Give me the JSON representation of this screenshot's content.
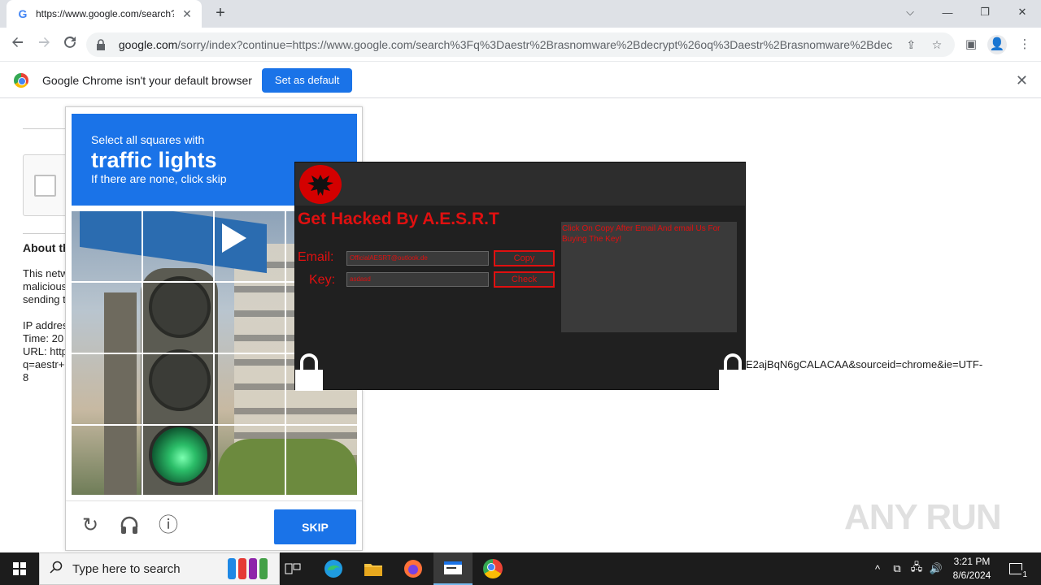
{
  "browser": {
    "tab_title": "https://www.google.com/search?",
    "tab_favicon": "G",
    "tab_close": "✕",
    "new_tab": "+",
    "window_controls": [
      "⌵",
      "—",
      "❐",
      "✕"
    ],
    "url_host": "google.com",
    "url_rest": "/sorry/index?continue=https://www.google.com/search%3Fq%3Daestr%2Brasnomware%2Bdecrypt%26oq%3Daestr%2Brasnomware%2Bdecrypt…"
  },
  "infobar": {
    "message": "Google Chrome isn't your default browser",
    "button": "Set as default",
    "close": "✕"
  },
  "page": {
    "about_partial": "About th",
    "lines": [
      "This netw",
      "malicious",
      "sending t",
      "IP addres",
      "Time: 20",
      "URL: http",
      "q=aestr+",
      "8"
    ],
    "url_tail": "E2ajBqN6gCALACAA&sourceid=chrome&ie=UTF-"
  },
  "captcha": {
    "line1": "Select all squares with",
    "line2": "traffic lights",
    "line3": "If there are none, click skip",
    "skip": "SKIP",
    "icons": [
      "↻",
      "🎧",
      "ⓘ"
    ]
  },
  "ransomware": {
    "title": "Get Hacked By A.E.S.R.T",
    "email_label": "Email:",
    "email_value": "OfficialAESRT@outlook.de",
    "key_label": "Key:",
    "key_value": "asdasd",
    "copy_button": "Copy",
    "check_button": "Check",
    "note": "Click On Copy After Email And email Us For Buying The Key!",
    "emblem_icon": "eagle-icon"
  },
  "watermark": "ANY RUN",
  "taskbar": {
    "search_placeholder": "Type here to search",
    "time": "3:21 PM",
    "date": "8/6/2024",
    "notifications": "1"
  },
  "colors": {
    "chrome_blue": "#1a73e8",
    "ransom_red": "#e01010",
    "ransom_bg": "#202020"
  }
}
